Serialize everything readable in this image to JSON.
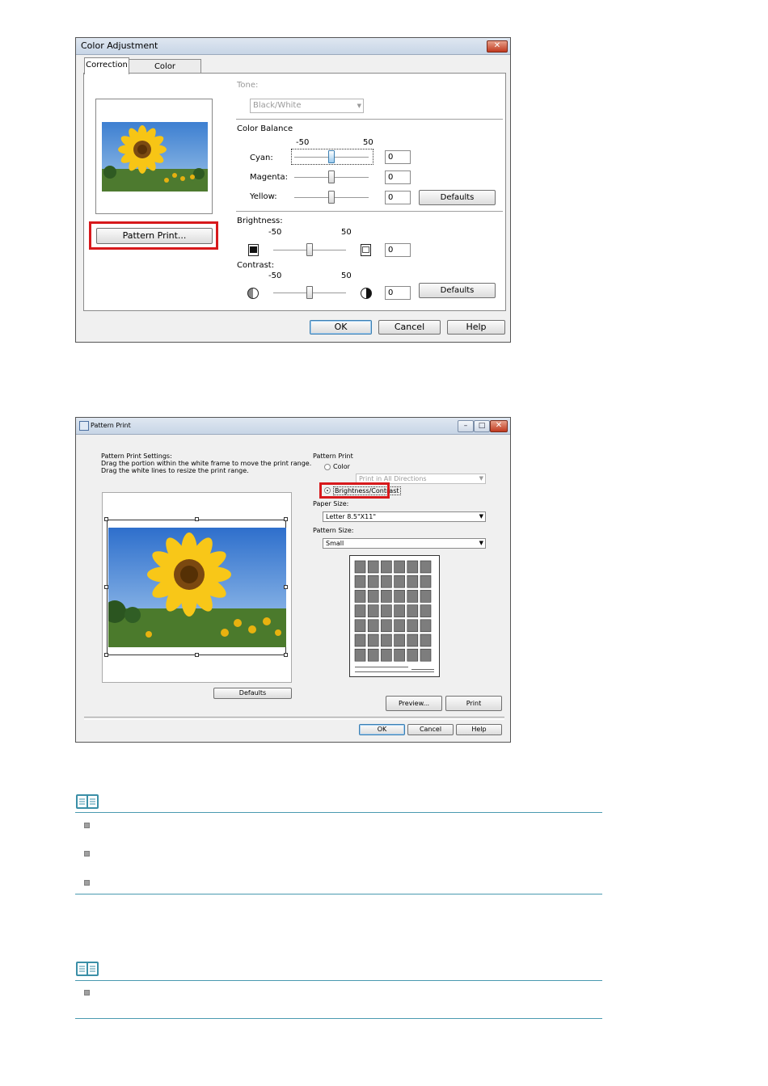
{
  "dialog1": {
    "title": "Color Adjustment",
    "close_glyph": "✕",
    "tabs": [
      "Correction",
      "Color Management"
    ],
    "tone_label": "Tone:",
    "tone_value": "Black/White",
    "color_balance_label": "Color Balance",
    "scale_min": "-50",
    "scale_max": "50",
    "cyan": {
      "label": "Cyan:",
      "value": "0"
    },
    "magenta": {
      "label": "Magenta:",
      "value": "0"
    },
    "yellow": {
      "label": "Yellow:",
      "value": "0"
    },
    "defaults_label": "Defaults",
    "brightness": {
      "label": "Brightness:",
      "value": "0"
    },
    "contrast": {
      "label": "Contrast:",
      "value": "0"
    },
    "pattern_print_button": "Pattern Print...",
    "ok_label": "OK",
    "cancel_label": "Cancel",
    "help_label": "Help"
  },
  "dialog2": {
    "title": "Pattern Print",
    "settings_heading": "Pattern Print Settings:",
    "settings_line1": "Drag the portion within the white frame to move the print range.",
    "settings_line2": "Drag the white lines to resize the print range.",
    "pattern_print_label": "Pattern Print",
    "option_color": "Color",
    "direction_value": "Print in All Directions",
    "option_brightness": "Brightness/Contrast",
    "paper_size_label": "Paper Size:",
    "paper_size_value": "Letter 8.5\"X11\"",
    "pattern_size_label": "Pattern Size:",
    "pattern_size_value": "Small",
    "defaults_label": "Defaults",
    "preview_label": "Preview...",
    "print_label": "Print",
    "ok_label": "OK",
    "cancel_label": "Cancel",
    "help_label": "Help",
    "pattern_grid": {
      "rows": 7,
      "cols": 6
    }
  },
  "colors": {
    "highlight": "#d7191c",
    "note_rule": "#4a9ab0"
  },
  "icons": {
    "note": "open-book-icon",
    "bullet": "gray-square-bullet-icon"
  }
}
